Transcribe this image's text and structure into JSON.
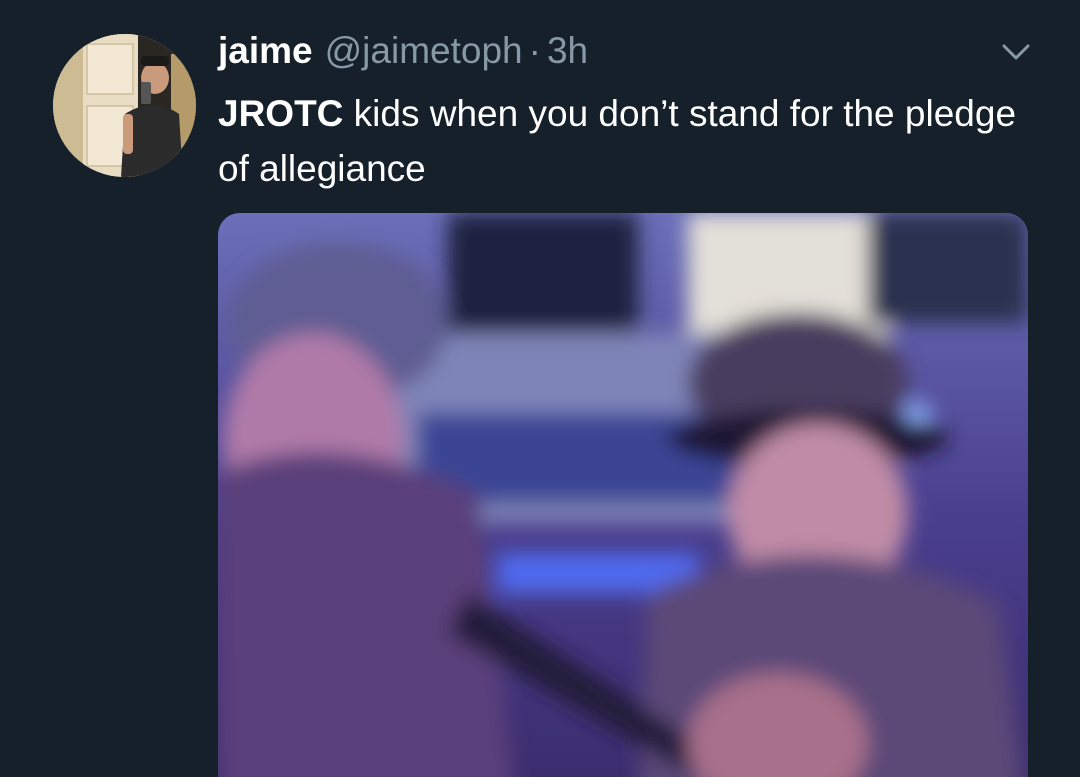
{
  "tweet": {
    "display_name": "jaime",
    "handle": "@jaimetoph",
    "separator": "·",
    "time": "3h",
    "text_bold": "JROTC",
    "text_rest": " kids when you don’t stand for the pledge of allegiance",
    "avatar_icon": "profile-photo",
    "menu_icon": "chevron-down-icon",
    "media_icon": "video-still"
  },
  "colors": {
    "background": "#15202b",
    "text_primary": "#ffffff",
    "text_secondary": "#8899a6"
  }
}
